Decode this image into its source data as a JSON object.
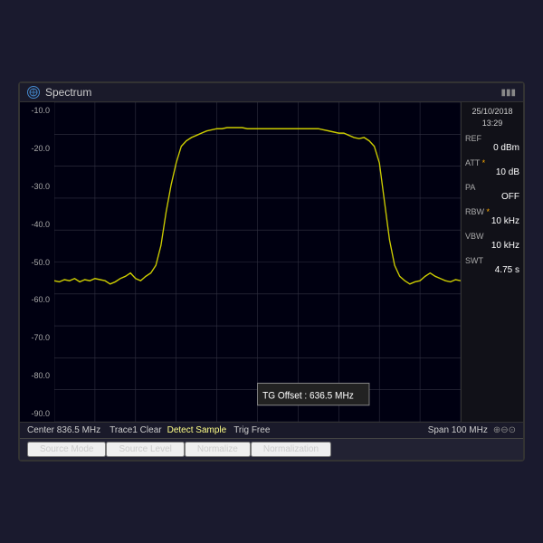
{
  "title": "Spectrum",
  "battery": "▮▮▮",
  "datetime": {
    "date": "25/10/2018",
    "time": "13:29"
  },
  "right_panel": {
    "ref_label": "REF",
    "ref_value": "0 dBm",
    "att_label": "ATT *",
    "att_value": "10 dB",
    "pa_label": "PA",
    "pa_value": "OFF",
    "rbw_label": "RBW *",
    "rbw_value": "10 kHz",
    "vbw_label": "VBW",
    "vbw_value": "10 kHz",
    "swt_label": "SWT",
    "swt_value": "4.75 s"
  },
  "y_axis": [
    "-10.0",
    "-20.0",
    "-30.0",
    "-40.0",
    "-50.0",
    "-60.0",
    "-70.0",
    "-80.0",
    "-90.0"
  ],
  "tg_offset": {
    "label": "TG Offset :",
    "value": "636.5 MHz"
  },
  "bottom_bar": {
    "center_freq": "Center  836.5 MHz",
    "trace_info": "Trace1  Clear",
    "detect_sample": "Detect  Sample",
    "trig_free": "Trig  Free",
    "span": "Span  100 MHz",
    "nav_icons": "⊕⊖⊙"
  },
  "second_bar": {
    "buttons": [
      "Source Mode",
      "Source Level",
      "Normalize",
      "Normalization"
    ]
  }
}
